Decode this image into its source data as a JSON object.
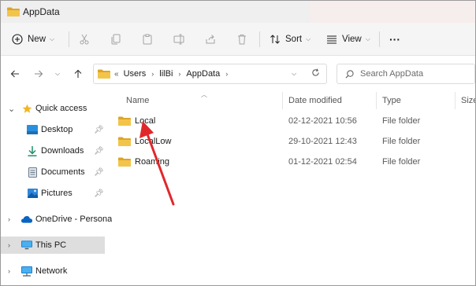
{
  "window": {
    "title": "AppData"
  },
  "toolbar": {
    "new_label": "New",
    "sort_label": "Sort",
    "view_label": "View",
    "more_label": "···"
  },
  "address": {
    "overflow": "«",
    "crumbs": [
      "Users",
      "lilBi",
      "AppData"
    ]
  },
  "search": {
    "placeholder": "Search AppData"
  },
  "nav": {
    "quick_access": "Quick access",
    "items": [
      {
        "label": "Desktop"
      },
      {
        "label": "Downloads"
      },
      {
        "label": "Documents"
      },
      {
        "label": "Pictures"
      }
    ],
    "onedrive": "OneDrive - Personal",
    "this_pc": "This PC",
    "network": "Network"
  },
  "columns": {
    "name": "Name",
    "date": "Date modified",
    "type": "Type",
    "size": "Size"
  },
  "files": [
    {
      "name": "Local",
      "date": "02-12-2021 10:56",
      "type": "File folder"
    },
    {
      "name": "LocalLow",
      "date": "29-10-2021 12:43",
      "type": "File folder"
    },
    {
      "name": "Roaming",
      "date": "01-12-2021 02:54",
      "type": "File folder"
    }
  ],
  "colors": {
    "folder": "#f3c44a",
    "folder_dark": "#dca52a",
    "accent": "#0a64c2",
    "arrow": "#e0282b",
    "selected": "#dedede"
  }
}
